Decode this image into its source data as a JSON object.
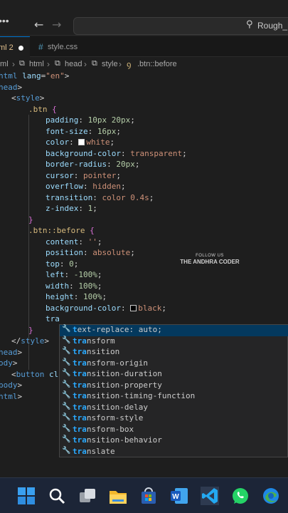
{
  "titlebar": {
    "search_text": "Rough_F",
    "icons": [
      "menu-icon",
      "arrow-left-icon",
      "arrow-right-icon",
      "search-icon"
    ]
  },
  "tabs": [
    {
      "label": "ml 2",
      "modified": true,
      "active": true
    },
    {
      "label": "style.css",
      "icon": "#",
      "active": false
    }
  ],
  "breadcrumb": [
    "tml",
    "html",
    "head",
    "style",
    ".btn::before"
  ],
  "editor": {
    "lines": [
      {
        "a": "html",
        "b": " lang",
        "c": "=",
        "d": "\"en\"",
        "e": ">"
      },
      {
        "a": "head",
        "b": ">"
      },
      {
        "a": "<",
        "b": "style",
        "c": ">"
      },
      {
        "a": ".btn",
        "b": " {"
      },
      {
        "a": "padding",
        "b": ": ",
        "c": "10px 20px",
        "d": ";"
      },
      {
        "a": "font-size",
        "b": ": ",
        "c": "16px",
        "d": ";"
      },
      {
        "a": "color",
        "b": ": ",
        "c": "white",
        "d": ";"
      },
      {
        "a": "background-color",
        "b": ": ",
        "c": "transparent",
        "d": ";"
      },
      {
        "a": "border-radius",
        "b": ": ",
        "c": "20px",
        "d": ";"
      },
      {
        "a": "cursor",
        "b": ": ",
        "c": "pointer",
        "d": ";"
      },
      {
        "a": "overflow",
        "b": ": ",
        "c": "hidden",
        "d": ";"
      },
      {
        "a": "transition",
        "b": ": ",
        "c": "color 0.4s",
        "d": ";"
      },
      {
        "a": "z-index",
        "b": ": ",
        "c": "1",
        "d": ";"
      },
      {
        "a": "}"
      },
      {
        "a": ".btn::before",
        "b": " {"
      },
      {
        "a": "content",
        "b": ": ",
        "c": "''",
        "d": ";"
      },
      {
        "a": "position",
        "b": ": ",
        "c": "absolute",
        "d": ";"
      },
      {
        "a": "top",
        "b": ": ",
        "c": "0",
        "d": ";"
      },
      {
        "a": "left",
        "b": ": ",
        "c": "-100%",
        "d": ";"
      },
      {
        "a": "width",
        "b": ": ",
        "c": "100%",
        "d": ";"
      },
      {
        "a": "height",
        "b": ": ",
        "c": "100%",
        "d": ";"
      },
      {
        "a": "background-color",
        "b": ": ",
        "c": "black",
        "d": ";"
      },
      {
        "a": "tra"
      },
      {
        "a": "}"
      },
      {
        "a": "</",
        "b": "style",
        "c": ">"
      },
      {
        "a": "head",
        "b": ">"
      },
      {
        "a": "ody",
        "b": ">"
      },
      {
        "a": "<",
        "b": "button",
        "c": " cla"
      },
      {
        "a": "body",
        "b": ">"
      },
      {
        "a": "html",
        "b": ">"
      }
    ],
    "swatch_white": "#ffffff",
    "swatch_black": "#000000"
  },
  "watermark": {
    "line1": "FOLLOW US",
    "line2": "THE ANDHRA CODER"
  },
  "suggestions": [
    {
      "pre": "t",
      "rest": "ext-replace: auto;"
    },
    {
      "pre": "tra",
      "rest": "nsform"
    },
    {
      "pre": "tra",
      "rest": "nsition"
    },
    {
      "pre": "tra",
      "rest": "nsform-origin"
    },
    {
      "pre": "tra",
      "rest": "nsition-duration"
    },
    {
      "pre": "tra",
      "rest": "nsition-property"
    },
    {
      "pre": "tra",
      "rest": "nsition-timing-function"
    },
    {
      "pre": "tra",
      "rest": "nsition-delay"
    },
    {
      "pre": "tra",
      "rest": "nsform-style"
    },
    {
      "pre": "tra",
      "rest": "nsform-box"
    },
    {
      "pre": "tra",
      "rest": "nsition-behavior"
    },
    {
      "pre": "tra",
      "rest": "nslate"
    }
  ],
  "taskbar": [
    "windows-start-icon",
    "search-icon",
    "task-view-icon",
    "file-explorer-icon",
    "microsoft-store-icon",
    "word-icon",
    "vscode-icon",
    "whatsapp-icon",
    "edge-icon"
  ],
  "colors": {
    "accent": "#0078d4",
    "suggest_highlight": "#2aaaff",
    "selected_row": "#04395e"
  }
}
